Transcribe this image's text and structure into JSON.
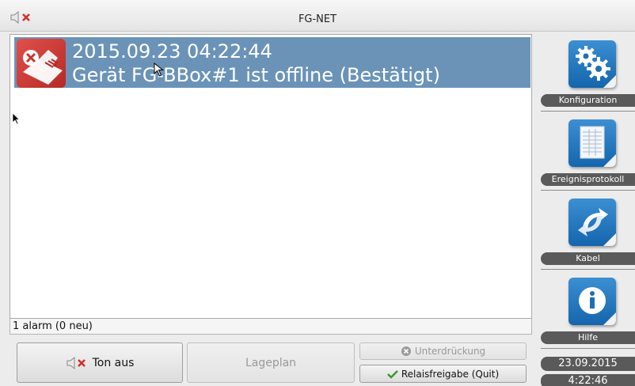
{
  "window": {
    "title": "FG-NET"
  },
  "alarm_list": {
    "alarms": [
      {
        "timestamp": "2015.09.23 04:22:44",
        "message": "Gerät FG-BBox#1 ist offline (Bestätigt)"
      }
    ],
    "status": "1 alarm (0 neu)"
  },
  "buttons": {
    "ton_aus": "Ton aus",
    "lageplan": "Lageplan",
    "unterdrueckung": "Unterdrückung",
    "relaisfreigabe": "Relaisfreigabe (Quit)"
  },
  "sidebar": {
    "items": [
      {
        "label": "Konfiguration",
        "icon": "gears-icon"
      },
      {
        "label": "Ereignisprotokoll",
        "icon": "document-icon"
      },
      {
        "label": "Kabel",
        "icon": "arrows-icon"
      },
      {
        "label": "Hilfe",
        "icon": "info-icon"
      }
    ],
    "date": "23.09.2015",
    "time": "4:22:46"
  },
  "colors": {
    "accent": "#1465ad",
    "selection": "#6b93b8",
    "alarm_icon": "#c8342f"
  }
}
